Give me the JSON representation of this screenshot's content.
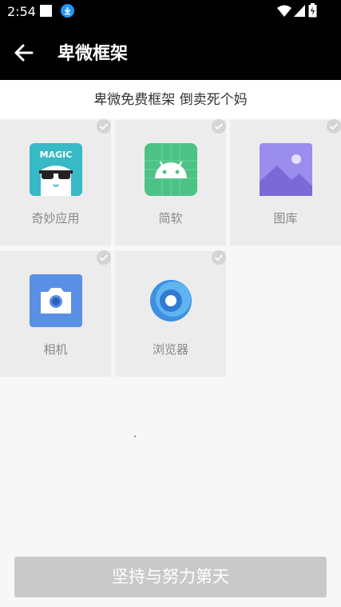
{
  "status_bar": {
    "time": "2:54"
  },
  "app_bar": {
    "title": "卑微框架"
  },
  "subtitle": "卑微免费框架 倒卖死个妈",
  "apps": [
    {
      "label": "奇妙应用",
      "icon": "magic-sunglasses-icon",
      "icon_text": "MAGIC",
      "color": "#37b9c6"
    },
    {
      "label": "简软",
      "icon": "android-robot-icon",
      "color": "#4cc286"
    },
    {
      "label": "图库",
      "icon": "gallery-picture-icon",
      "color": "#8f7ee6"
    },
    {
      "label": "相机",
      "icon": "camera-icon",
      "color": "#5a8fe6"
    },
    {
      "label": "浏览器",
      "icon": "browser-circle-icon",
      "color": "#3d8fe0"
    }
  ],
  "bottom_button": {
    "label": "坚持与努力第天"
  }
}
